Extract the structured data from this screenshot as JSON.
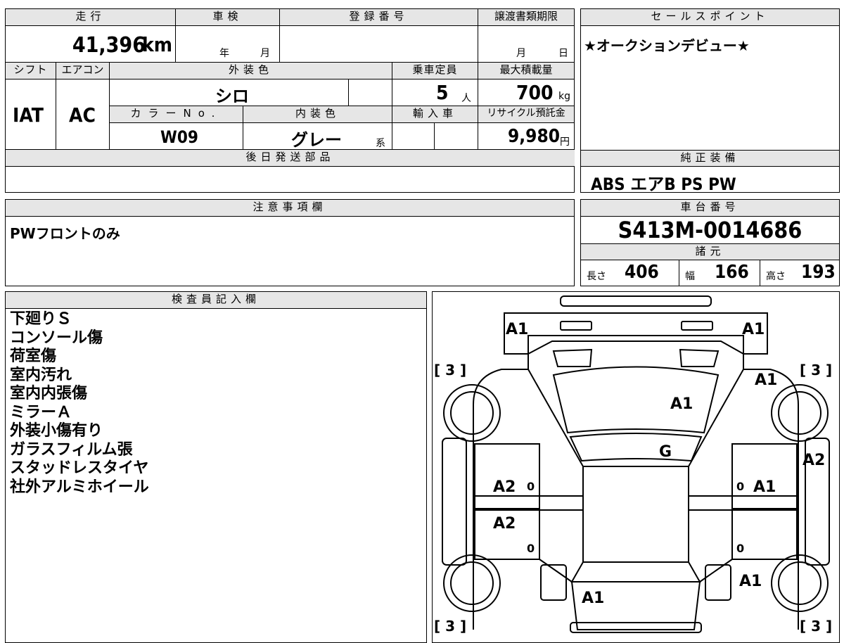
{
  "top_left_block": {
    "mileage_label": "走行",
    "mileage_value": "41,396",
    "mileage_unit": "km",
    "inspection_label": "車検",
    "inspection_year": "年",
    "inspection_month": "月",
    "registration_label": "登録番号",
    "transfer_deadline_label": "譲渡書類期限",
    "transfer_month": "月",
    "transfer_day": "日",
    "shift_label": "シフト",
    "shift_value": "IAT",
    "ac_label": "エアコン",
    "ac_value": "AC",
    "exterior_label": "外装色",
    "exterior_value": "シロ",
    "capacity_label": "乗車定員",
    "capacity_value": "5",
    "capacity_unit": "人",
    "maxload_label": "最大積載量",
    "maxload_value": "700",
    "maxload_unit": "kg",
    "color_no_label": "カラーNo.",
    "color_no_value": "W09",
    "interior_label": "内装色",
    "interior_value": "グレー",
    "interior_suffix": "系",
    "import_label": "輸入車",
    "recycle_label": "リサイクル預託金",
    "recycle_value": "9,980",
    "recycle_unit": "円",
    "later_parts_label": "後日発送部品"
  },
  "sales_point": {
    "label": "セールスポイント",
    "text": "★オークションデビュー★"
  },
  "genuine_equipment": {
    "label": "純正装備",
    "text": "ABS エアB PS PW"
  },
  "notes": {
    "label": "注意事項欄",
    "text": "PWフロントのみ"
  },
  "chassis": {
    "label": "車台番号",
    "value": "S413M-0014686",
    "spec_label": "諸元",
    "length_label": "長さ",
    "length_value": "406",
    "width_label": "幅",
    "width_value": "166",
    "height_label": "高さ",
    "height_value": "193"
  },
  "inspector": {
    "label": "検査員記入欄",
    "lines": [
      "下廻りＳ",
      "コンソール傷",
      "荷室傷",
      "室内汚れ",
      "室内内張傷",
      "ミラーＡ",
      "外装小傷有り",
      "ガラスフィルム張",
      "スタッドレスタイヤ",
      "社外アルミホイール"
    ]
  },
  "diagram_marks": {
    "front_left": "A1",
    "front_right": "A1",
    "bracket_tl": "[ 3 ]",
    "bracket_tr": "[ 3 ]",
    "bracket_bl": "[ 3 ]",
    "bracket_br": "[ 3 ]",
    "fender_right": "A1",
    "hood": "A1",
    "windshield": "G",
    "right_rear_panel": "A2",
    "left_front_door": "A2",
    "right_front_door": "A1",
    "left_rear_door": "A2",
    "right_rear_quarter": "A1",
    "tailgate": "A1",
    "zero_1": "0",
    "zero_2": "0",
    "zero_3": "0",
    "zero_4": "0"
  }
}
